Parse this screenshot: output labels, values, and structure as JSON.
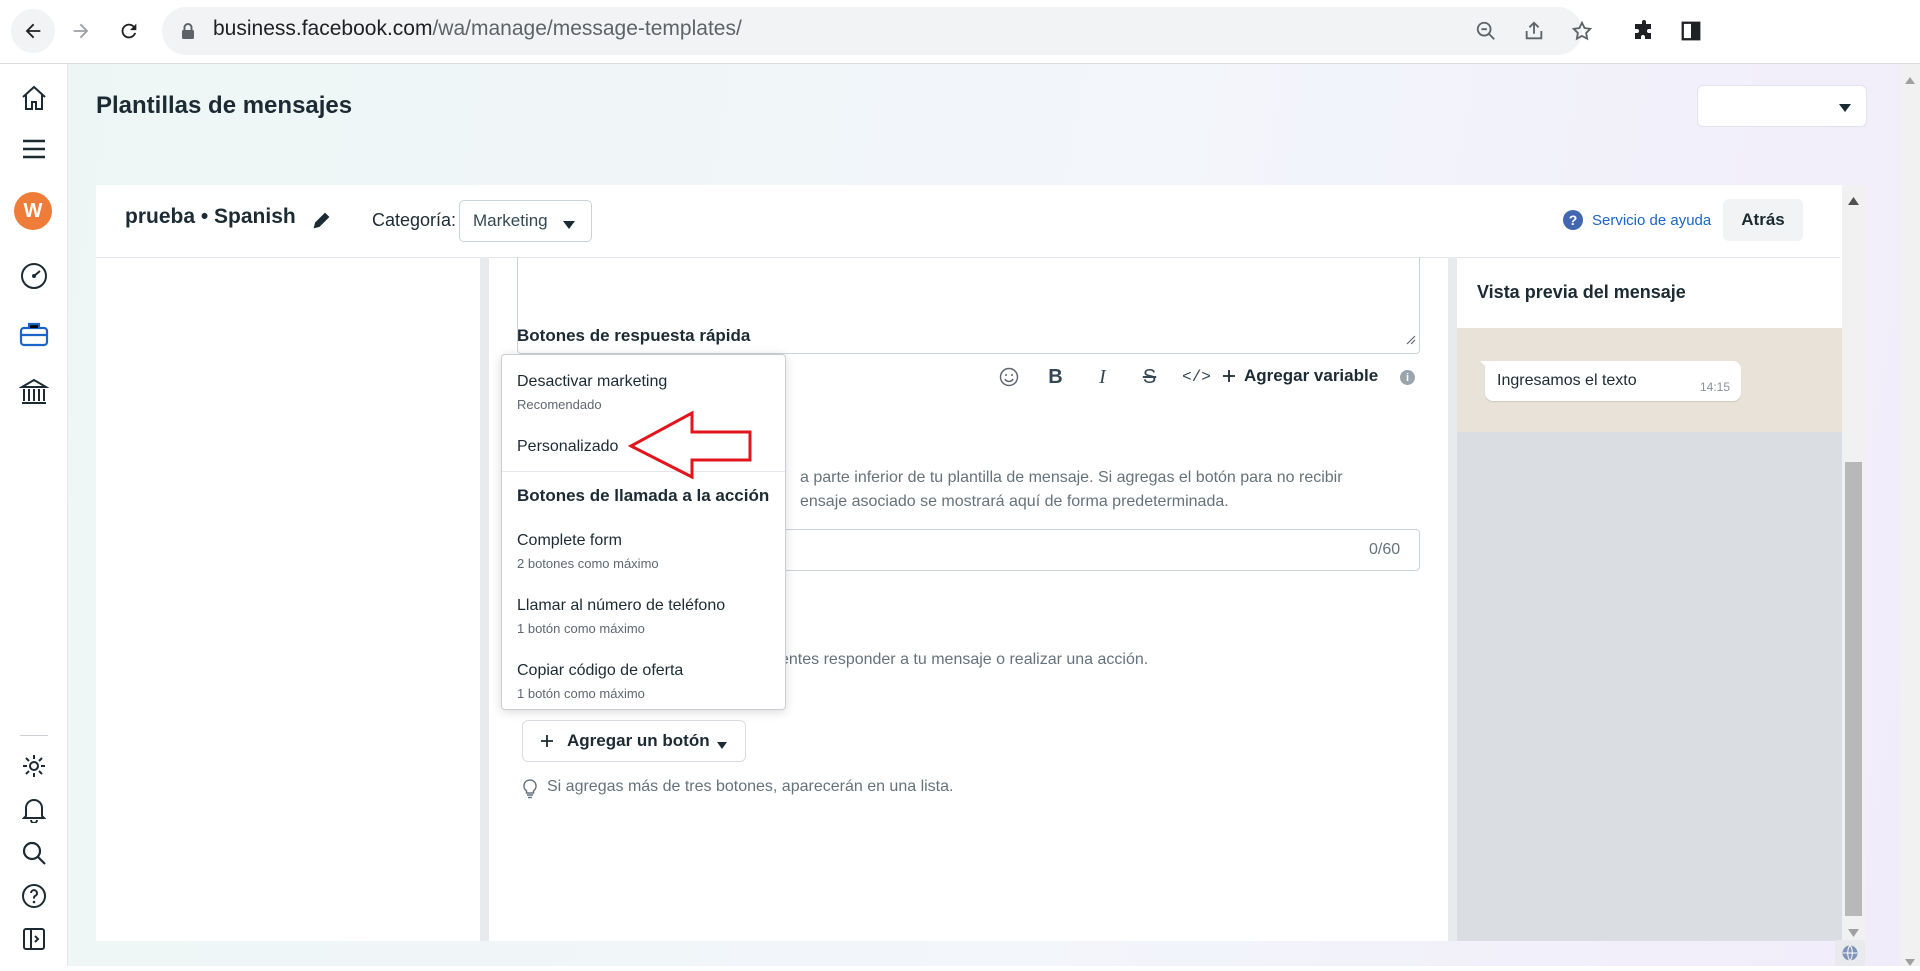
{
  "browser": {
    "url_host": "business.facebook.com",
    "url_path": "/wa/manage/message-templates/"
  },
  "rail": {
    "avatar_letter": "W"
  },
  "page": {
    "title": "Plantillas de mensajes"
  },
  "header": {
    "template_name": "prueba • Spanish",
    "category_label": "Categoría:",
    "category_value": "Marketing",
    "help_label": "Servicio de ayuda",
    "back_label": "Atrás"
  },
  "editor": {
    "quick_reply_title": "Botones de respuesta rápida",
    "add_variable_label": "Agregar variable",
    "info_icon": "i",
    "footer_description": "a parte inferior de tu plantilla de mensaje. Si agregas el botón para no recibir\nensaje asociado se mostrará aquí de forma predeterminada.",
    "footer_counter": "0/60",
    "buttons_description": "entes responder a tu mensaje o realizar una acción.",
    "add_button_label": "Agregar un botón",
    "tip_text": "Si agregas más de tres botones, aparecerán en una lista."
  },
  "menu": {
    "items": [
      {
        "label": "Desactivar marketing",
        "sub": "Recomendado"
      },
      {
        "label": "Personalizado",
        "sub": ""
      }
    ],
    "cta_heading": "Botones de llamada a la acción",
    "cta_items": [
      {
        "label": "Complete form",
        "sub": "2 botones como máximo"
      },
      {
        "label": "Llamar al número de teléfono",
        "sub": "1 botón como máximo"
      },
      {
        "label": "Copiar código de oferta",
        "sub": "1 botón como máximo"
      }
    ]
  },
  "preview": {
    "title": "Vista previa del mensaje",
    "message_text": "Ingresamos el texto",
    "message_time": "14:15"
  },
  "colors": {
    "annotation_arrow": "#e3141b",
    "link": "#1a64c9",
    "avatar": "#f07c3a"
  }
}
